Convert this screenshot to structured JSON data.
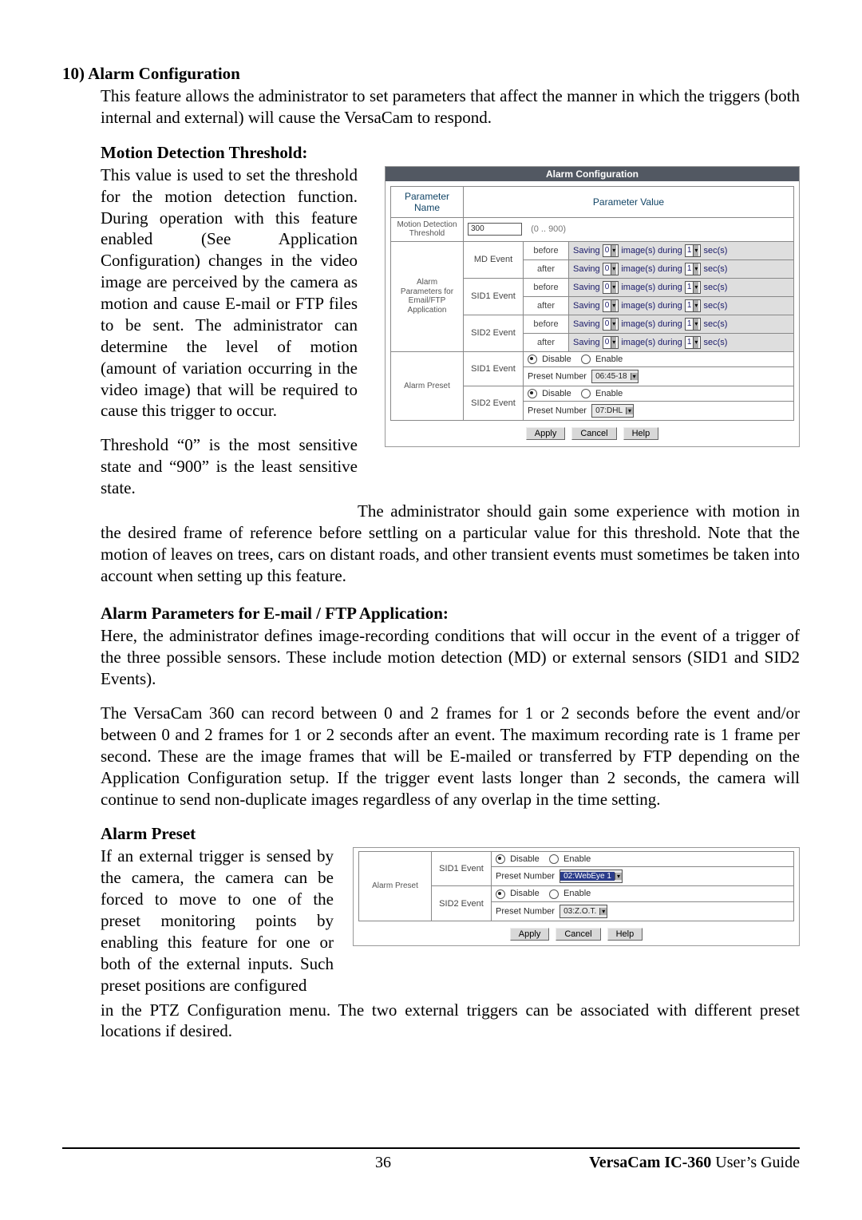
{
  "sections": {
    "s10": {
      "title": "10) Alarm Configuration",
      "intro": "This feature allows the administrator to set parameters that affect the manner in which the triggers (both internal and external) will cause the VersaCam to respond."
    },
    "motion_threshold": {
      "title": "Motion Detection Threshold:",
      "p1": "This value is used to set the threshold for the motion detection function.  During operation with this feature enabled (See Application Configuration) changes in the video image are perceived by the camera as motion and cause E-mail or FTP files to be sent.   The administrator can determine the level of motion (amount of variation occurring in the video image) that will be required to cause this trigger to occur.",
      "p2a": "Threshold “0” is the most sensitive state and “900” is the least sensitive state.",
      "p2b": "The administrator should gain some experience with motion in the desired frame of reference before settling on a particular value for this threshold.   Note that the motion of leaves on trees, cars on distant roads, and other transient events must sometimes be taken into account when setting up this feature."
    },
    "alarm_params": {
      "title": "Alarm Parameters for E-mail / FTP Application:",
      "p1": "Here, the administrator defines image-recording conditions that will occur in the event of a trigger of the three possible sensors.   These include motion detection (MD) or external sensors (SID1 and SID2 Events).",
      "p2": "The VersaCam 360 can record between 0 and 2 frames for 1 or 2 seconds before the event and/or between 0 and 2 frames for 1 or 2 seconds after an event.   The maximum recording rate is 1 frame per second.   These are the image frames that will be E-mailed or transferred by FTP depending on the Application Configuration setup.   If the trigger event lasts longer than 2 seconds, the camera will continue to send non-duplicate images regardless of any overlap in the time setting."
    },
    "alarm_preset": {
      "title": "Alarm Preset",
      "p1": "If an external trigger is sensed by the camera, the camera can be forced to move to one of the preset monitoring points by enabling this feature for one or both of the external inputs.  Such preset positions are configured",
      "p2": "in the PTZ Configuration menu.   The two external triggers can be associated with different preset locations if desired."
    }
  },
  "fig1": {
    "title": "Alarm Configuration",
    "header_left": "Parameter Name",
    "header_right": "Parameter Value",
    "threshold": {
      "label": "Motion Detection Threshold",
      "value": "300",
      "range": "(0 .. 900)"
    },
    "params_label": "Alarm Parameters for Email/FTP Application",
    "events": [
      {
        "name": "MD Event",
        "before": {
          "label": "before",
          "frames": "0",
          "secs": "1",
          "text": [
            "Saving",
            " image(s) during",
            " sec(s)"
          ]
        },
        "after": {
          "label": "after",
          "frames": "0",
          "secs": "1",
          "text": [
            "Saving",
            " image(s) during",
            " sec(s)"
          ]
        }
      },
      {
        "name": "SID1 Event",
        "before": {
          "label": "before",
          "frames": "0",
          "secs": "1",
          "text": [
            "Saving",
            " image(s) during",
            " sec(s)"
          ]
        },
        "after": {
          "label": "after",
          "frames": "0",
          "secs": "1",
          "text": [
            "Saving",
            " image(s) during",
            " sec(s)"
          ]
        }
      },
      {
        "name": "SID2 Event",
        "before": {
          "label": "before",
          "frames": "0",
          "secs": "1",
          "text": [
            "Saving",
            " image(s) during",
            " sec(s)"
          ]
        },
        "after": {
          "label": "after",
          "frames": "0",
          "secs": "1",
          "text": [
            "Saving",
            " image(s) during",
            " sec(s)"
          ]
        }
      }
    ],
    "preset_block": {
      "label": "Alarm Preset",
      "rows": [
        {
          "name": "SID1 Event",
          "disable": "Disable",
          "enable": "Enable",
          "pn_label": "Preset Number",
          "pn_value": "06:45-18"
        },
        {
          "name": "SID2 Event",
          "disable": "Disable",
          "enable": "Enable",
          "pn_label": "Preset Number",
          "pn_value": "07:DHL"
        }
      ]
    },
    "buttons": {
      "apply": "Apply",
      "cancel": "Cancel",
      "help": "Help"
    }
  },
  "fig2": {
    "label": "Alarm Preset",
    "rows": [
      {
        "name": "SID1 Event",
        "disable": "Disable",
        "enable": "Enable",
        "pn_label": "Preset Number",
        "pn_value": "02:WebEye 1",
        "hilite": true
      },
      {
        "name": "SID2 Event",
        "disable": "Disable",
        "enable": "Enable",
        "pn_label": "Preset Number",
        "pn_value": "03:Z.O.T.",
        "hilite": false
      }
    ],
    "buttons": {
      "apply": "Apply",
      "cancel": "Cancel",
      "help": "Help"
    }
  },
  "footer": {
    "page": "36",
    "guide_bold": "VersaCam IC-360",
    "guide_rest": " User’s Guide"
  }
}
